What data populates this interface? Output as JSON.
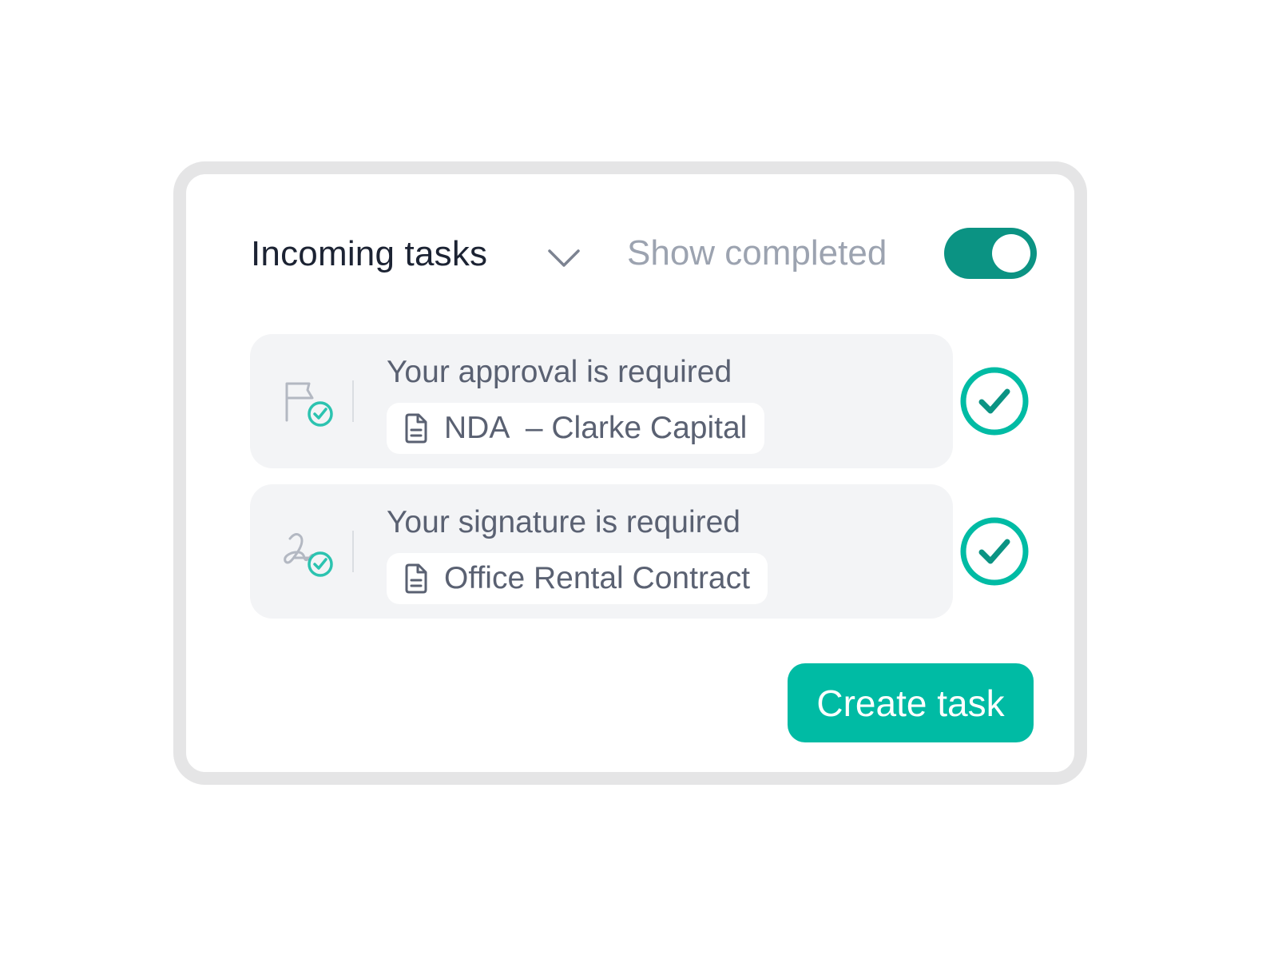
{
  "header": {
    "title": "Incoming tasks",
    "dropdown_icon": "chevron-down-icon",
    "show_completed_label": "Show completed",
    "show_completed_on": true
  },
  "tasks": [
    {
      "title": "Your approval is required",
      "icon": "flag-check-icon",
      "document": "NDA  – Clarke Capital",
      "document_icon": "document-icon",
      "action_icon": "check-circle-icon"
    },
    {
      "title": "Your signature is required",
      "icon": "signature-check-icon",
      "document": "Office Rental Contract",
      "document_icon": "document-icon",
      "action_icon": "check-circle-icon"
    }
  ],
  "actions": {
    "create_task_label": "Create task"
  },
  "colors": {
    "accent": "#00bba4",
    "toggle": "#0b9383",
    "frame": "#e5e5e6",
    "card": "#f3f4f6",
    "title_text": "#1c2333",
    "muted_text": "#9ca3b0",
    "body_text": "#5a6172"
  }
}
